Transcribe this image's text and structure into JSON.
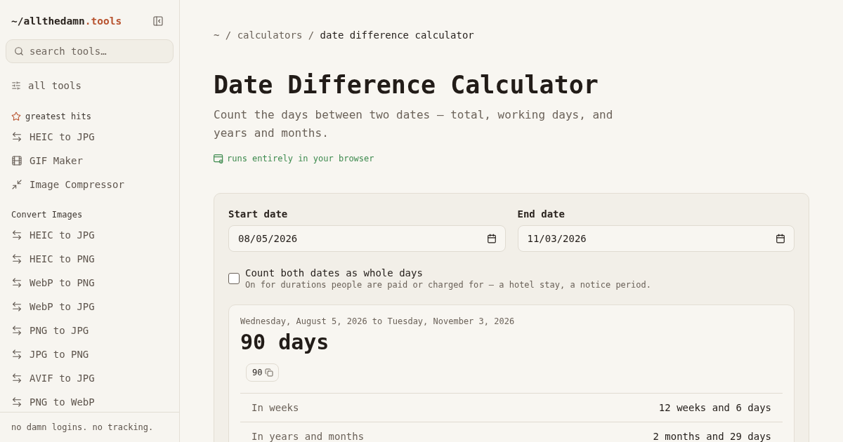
{
  "sidebar": {
    "logo": {
      "name": "~/allthedamn",
      "tld": ".tools"
    },
    "search": {
      "placeholder": "search tools…"
    },
    "all_tools": "all tools",
    "sections": [
      {
        "title": "greatest hits",
        "kind": "starred",
        "items": [
          {
            "label": "HEIC to JPG",
            "kind": "convert"
          },
          {
            "label": "GIF Maker",
            "kind": "film"
          },
          {
            "label": "Image Compressor",
            "kind": "compress"
          }
        ]
      },
      {
        "title": "Convert Images",
        "kind": "plain",
        "items": [
          {
            "label": "HEIC to JPG",
            "kind": "convert"
          },
          {
            "label": "HEIC to PNG",
            "kind": "convert"
          },
          {
            "label": "WebP to PNG",
            "kind": "convert"
          },
          {
            "label": "WebP to JPG",
            "kind": "convert"
          },
          {
            "label": "PNG to JPG",
            "kind": "convert"
          },
          {
            "label": "JPG to PNG",
            "kind": "convert"
          },
          {
            "label": "AVIF to JPG",
            "kind": "convert"
          },
          {
            "label": "PNG to WebP",
            "kind": "convert"
          }
        ]
      }
    ],
    "footer": "no damn logins. no tracking."
  },
  "breadcrumb": {
    "items": [
      {
        "kind": "link",
        "label": "~"
      },
      {
        "kind": "separator",
        "label": "/"
      },
      {
        "kind": "link",
        "label": "calculators"
      },
      {
        "kind": "separator",
        "label": "/"
      },
      {
        "kind": "current",
        "label": "date difference calculator"
      }
    ]
  },
  "header": {
    "title": "Date Difference Calculator",
    "subtitle": "Count the days between two dates — total, working days, and years and months.",
    "badge": "runs entirely in your browser"
  },
  "form": {
    "start_date": {
      "label": "Start date",
      "value": "08/05/2026"
    },
    "end_date": {
      "label": "End date",
      "value": "11/03/2026"
    },
    "whole_days": {
      "label": "Count both dates as whole days",
      "hint": "On for durations people are paid or charged for — a hotel stay, a notice period.",
      "checked": false
    }
  },
  "result": {
    "range": "Wednesday, August 5, 2026 to Tuesday, November 3, 2026",
    "total": "90 days",
    "copy_value": "90",
    "rows": [
      {
        "label": "In weeks",
        "value": "12 weeks and 6 days"
      },
      {
        "label": "In years and months",
        "value": "2 months and 29 days"
      }
    ]
  }
}
